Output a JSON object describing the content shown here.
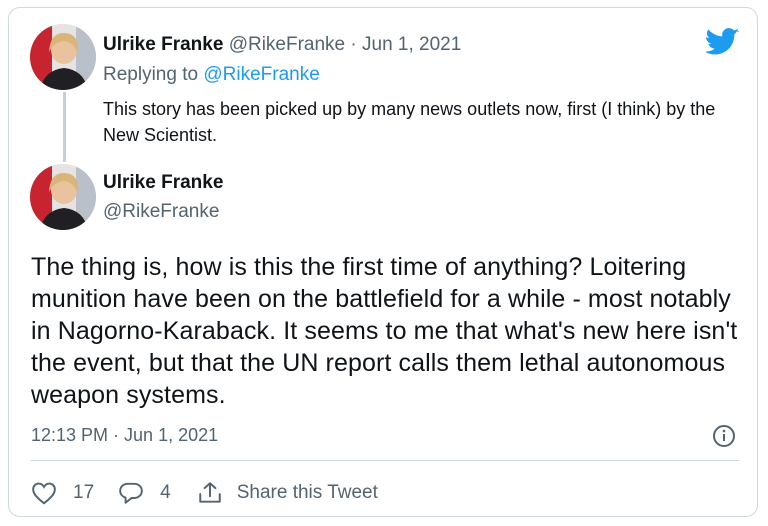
{
  "reply_tweet": {
    "author_name": "Ulrike Franke",
    "author_handle": "@RikeFranke",
    "separator": "·",
    "date": "Jun 1, 2021",
    "replying_prefix": "Replying to",
    "replying_handle": "@RikeFranke",
    "text": "This story has been picked up by many news outlets now, first (I think) by the New Scientist."
  },
  "main_tweet": {
    "author_name": "Ulrike Franke",
    "author_handle": "@RikeFranke",
    "text": "The thing is, how is this the first time of anything? Loitering munition have been on the battlefield for a while - most notably in Nagorno-Karaback. It seems to me that what's new here isn't the event, but that the UN report calls them lethal autonomous weapon systems.",
    "timestamp": "12:13 PM · Jun 1, 2021"
  },
  "actions": {
    "like_count": "17",
    "reply_count": "4",
    "share_label": "Share this Tweet"
  },
  "icons": {
    "brand": "twitter-bird-icon",
    "info": "info-icon",
    "like": "heart-icon",
    "reply": "speech-bubble-icon",
    "share": "share-upload-icon"
  },
  "colors": {
    "brand_blue": "#1d9bf0",
    "text": "#0f1419",
    "muted": "#536471",
    "border": "#cfd9de"
  }
}
